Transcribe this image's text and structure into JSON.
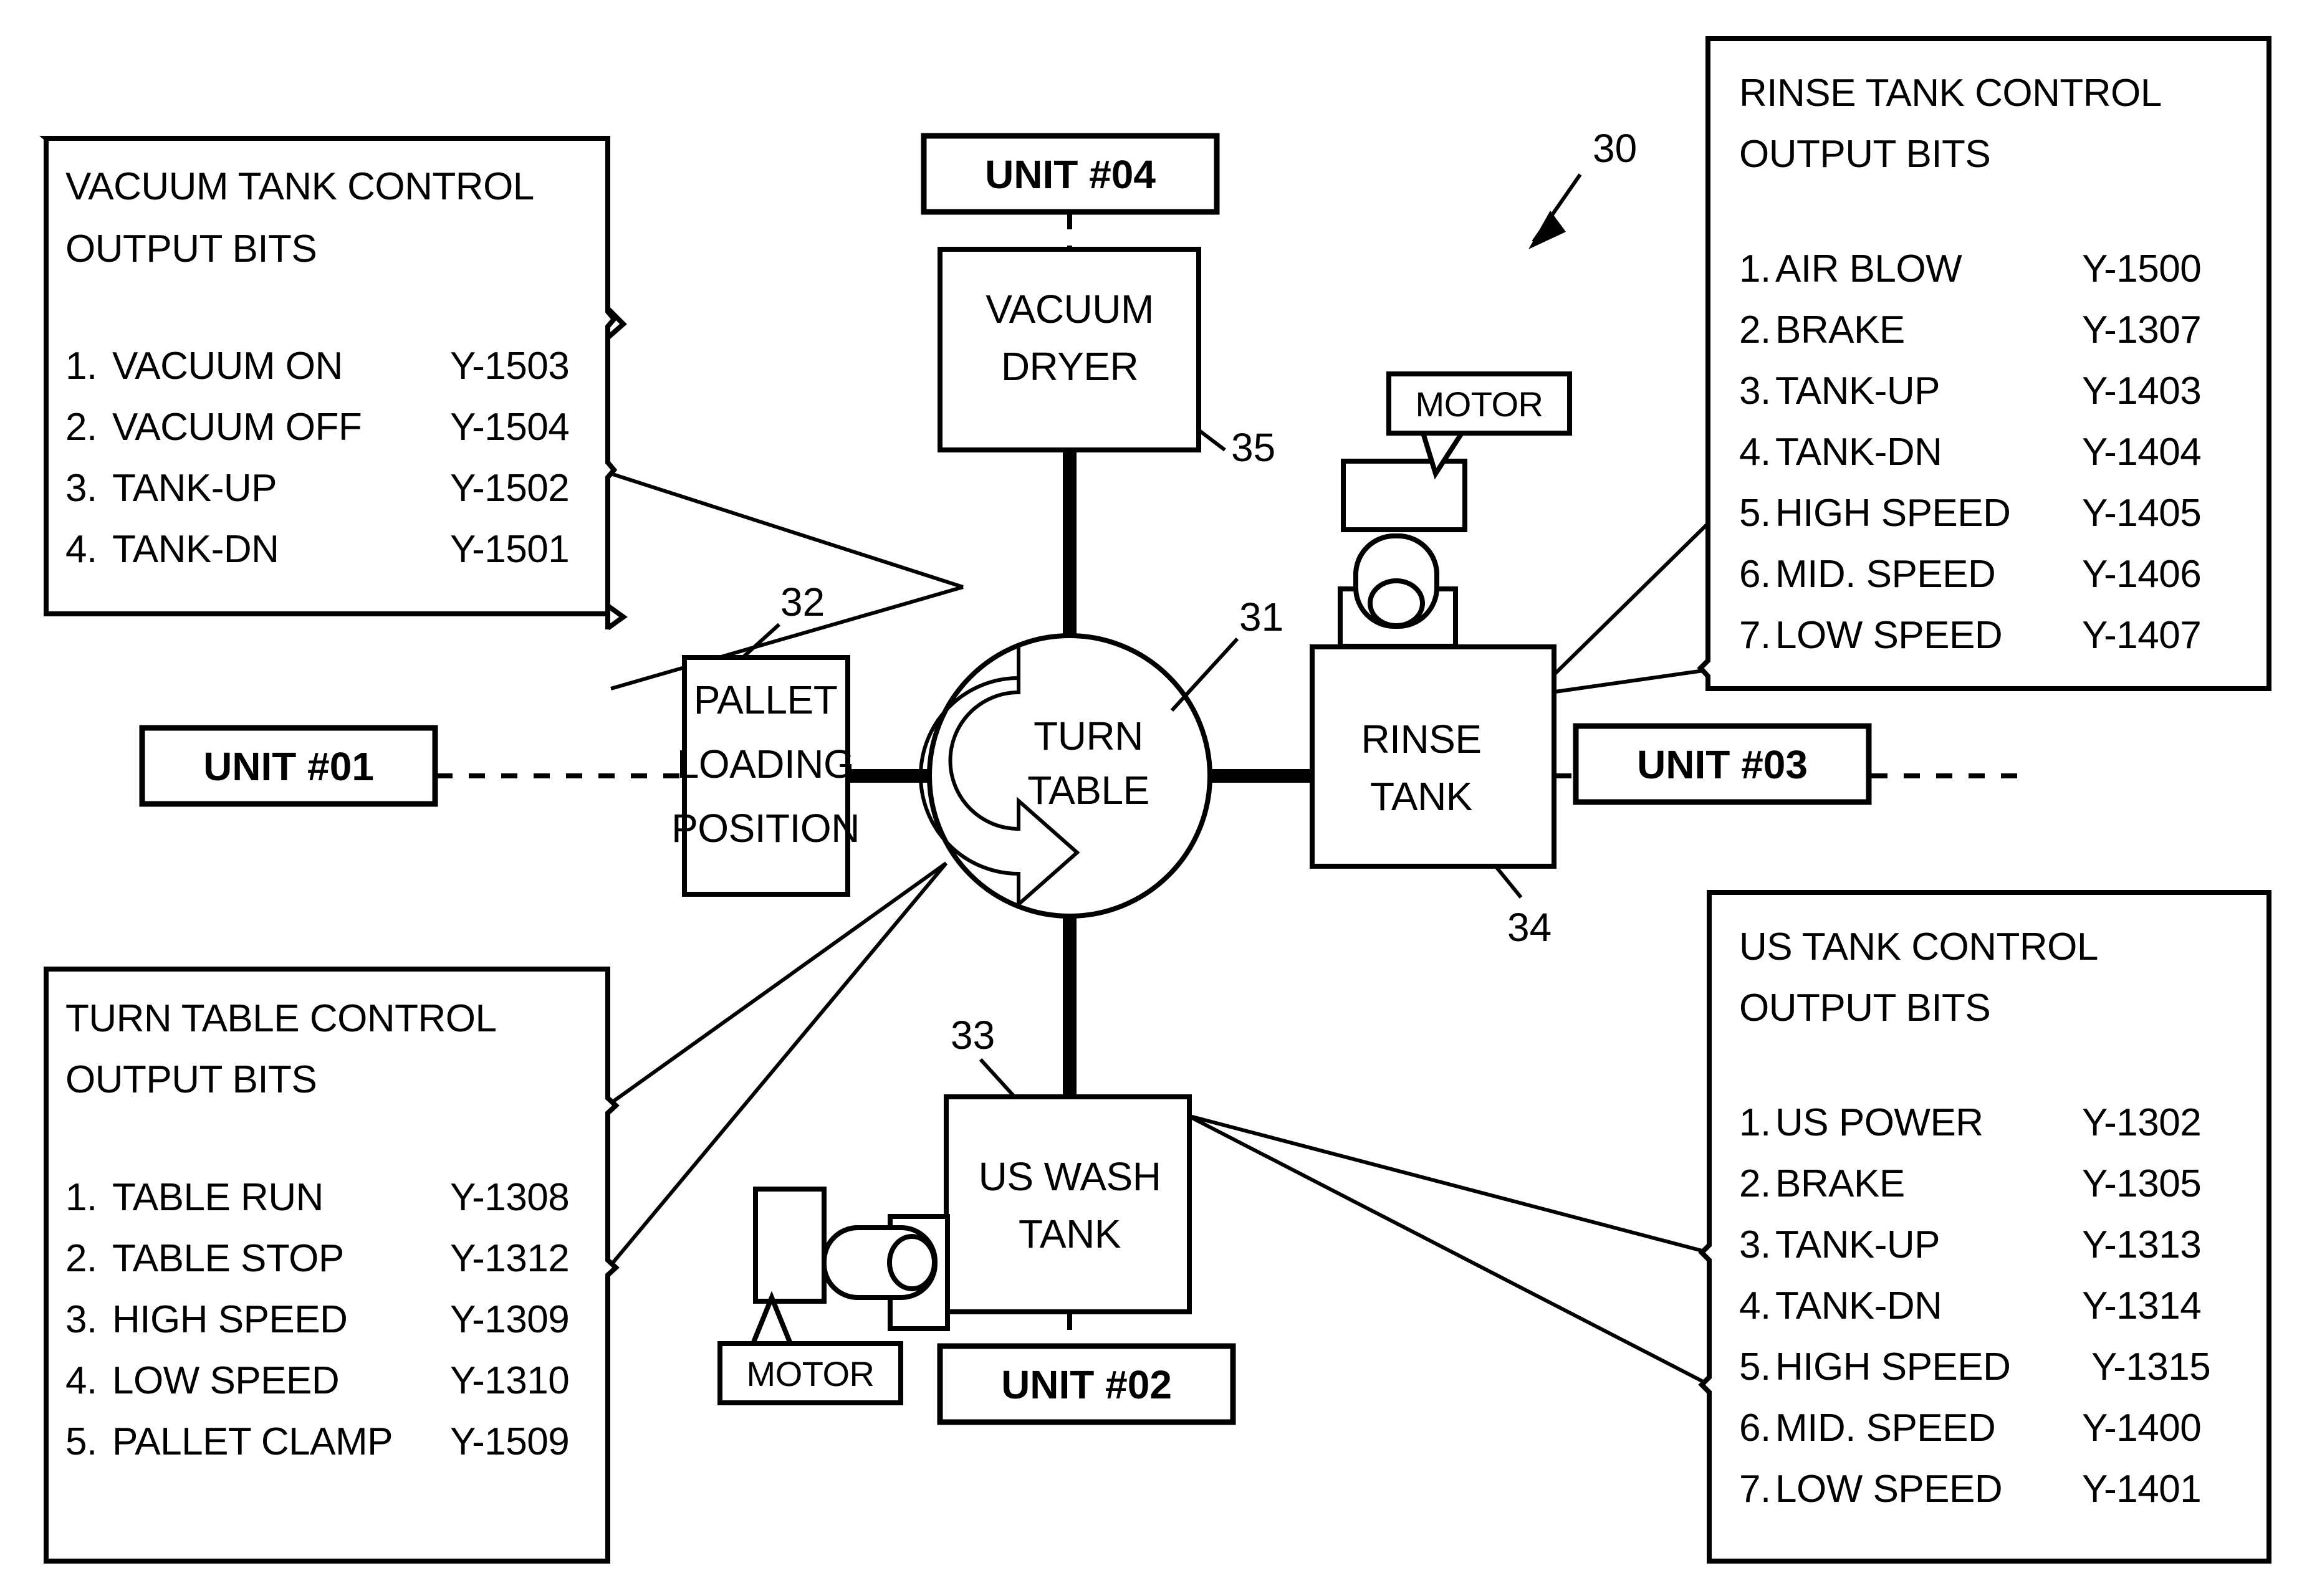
{
  "figure": {
    "reference_numeral": "30",
    "units": [
      {
        "id": "unit01",
        "label": "UNIT #01"
      },
      {
        "id": "unit02",
        "label": "UNIT #02"
      },
      {
        "id": "unit03",
        "label": "UNIT #03"
      },
      {
        "id": "unit04",
        "label": "UNIT #04"
      }
    ],
    "nodes": {
      "turntable": {
        "line1": "TURN",
        "line2": "TABLE",
        "ref": "31"
      },
      "pallet": {
        "line1": "PALLET",
        "line2": "LOADING",
        "line3": "POSITION",
        "ref": "32"
      },
      "vacuum_dryer": {
        "line1": "VACUUM",
        "line2": "DRYER",
        "ref": "35"
      },
      "rinse_tank": {
        "line1": "RINSE",
        "line2": "TANK",
        "ref": "34"
      },
      "us_wash_tank": {
        "line1": "US WASH",
        "line2": "TANK",
        "ref": "33"
      },
      "motor_rinse": {
        "label": "MOTOR"
      },
      "motor_us": {
        "label": "MOTOR"
      }
    }
  },
  "panels": {
    "vacuum": {
      "title_line1": "VACUUM TANK CONTROL",
      "title_line2": "OUTPUT BITS",
      "items": [
        {
          "num": "1.",
          "name": "VACUUM ON",
          "bit": "Y-1503"
        },
        {
          "num": "2.",
          "name": "VACUUM OFF",
          "bit": "Y-1504"
        },
        {
          "num": "3.",
          "name": "TANK-UP",
          "bit": "Y-1502"
        },
        {
          "num": "4.",
          "name": "TANK-DN",
          "bit": "Y-1501"
        }
      ]
    },
    "rinse": {
      "title_line1": "RINSE TANK CONTROL",
      "title_line2": "OUTPUT BITS",
      "items": [
        {
          "num": "1.",
          "name": "AIR BLOW",
          "bit": "Y-1500"
        },
        {
          "num": "2.",
          "name": "BRAKE",
          "bit": "Y-1307"
        },
        {
          "num": "3.",
          "name": "TANK-UP",
          "bit": "Y-1403"
        },
        {
          "num": "4.",
          "name": "TANK-DN",
          "bit": "Y-1404"
        },
        {
          "num": "5.",
          "name": "HIGH SPEED",
          "bit": "Y-1405"
        },
        {
          "num": "6.",
          "name": "MID. SPEED",
          "bit": "Y-1406"
        },
        {
          "num": "7.",
          "name": "LOW SPEED",
          "bit": "Y-1407"
        }
      ]
    },
    "turntable": {
      "title_line1": "TURN TABLE CONTROL",
      "title_line2": "OUTPUT BITS",
      "items": [
        {
          "num": "1.",
          "name": "TABLE RUN",
          "bit": "Y-1308"
        },
        {
          "num": "2.",
          "name": "TABLE STOP",
          "bit": "Y-1312"
        },
        {
          "num": "3.",
          "name": "HIGH SPEED",
          "bit": "Y-1309"
        },
        {
          "num": "4.",
          "name": "LOW SPEED",
          "bit": "Y-1310"
        },
        {
          "num": "5.",
          "name": "PALLET CLAMP",
          "bit": "Y-1509"
        }
      ]
    },
    "us": {
      "title_line1": "US TANK CONTROL",
      "title_line2": "OUTPUT BITS",
      "items": [
        {
          "num": "1.",
          "name": "US POWER",
          "bit": "Y-1302"
        },
        {
          "num": "2.",
          "name": "BRAKE",
          "bit": "Y-1305"
        },
        {
          "num": "3.",
          "name": "TANK-UP",
          "bit": "Y-1313"
        },
        {
          "num": "4.",
          "name": "TANK-DN",
          "bit": "Y-1314"
        },
        {
          "num": "5.",
          "name": "HIGH SPEED",
          "bit": "Y-1315"
        },
        {
          "num": "6.",
          "name": "MID. SPEED",
          "bit": "Y-1400"
        },
        {
          "num": "7.",
          "name": "LOW SPEED",
          "bit": "Y-1401"
        }
      ]
    }
  },
  "colors": {
    "ink": "#000000",
    "paper": "#ffffff"
  }
}
